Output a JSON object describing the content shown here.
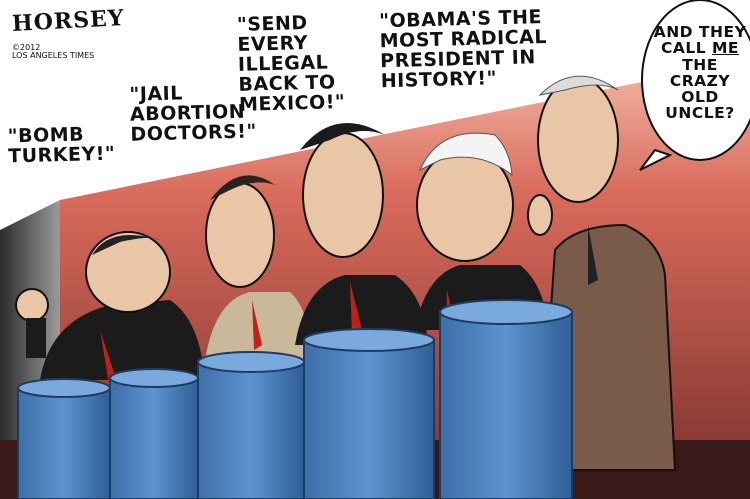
{
  "cartoon": {
    "signature": "Horsey",
    "credit_lines": "©2012\nLos Angeles Times",
    "quotes": [
      {
        "speaker": "candidate-1",
        "text": "\"Bomb\nTurkey!\""
      },
      {
        "speaker": "candidate-2",
        "text": "\"Jail\nAbortion\nDoctors!\""
      },
      {
        "speaker": "candidate-3",
        "text": "\"Send every\nillegal\nback to\nMexico!\""
      },
      {
        "speaker": "candidate-4",
        "text": "\"Obama's the\nmost radical\npresident in\nhistory!\""
      }
    ],
    "speech_bubble": {
      "line1": "And they\ncall ",
      "emphasis": "me",
      "line2": "\nthe crazy\nold uncle?"
    }
  },
  "colors": {
    "background_white": "#ffffff",
    "wall_red": "#d96b5c",
    "wall_dark": "#8a3b34",
    "podium_blue": "#4f86c6",
    "podium_shadow": "#2f5f95",
    "suit_dark": "#1b1b1b",
    "suit_brown": "#7a5a48",
    "tie_red": "#c0221a",
    "skin": "#e9c6a6",
    "ink": "#111111"
  }
}
